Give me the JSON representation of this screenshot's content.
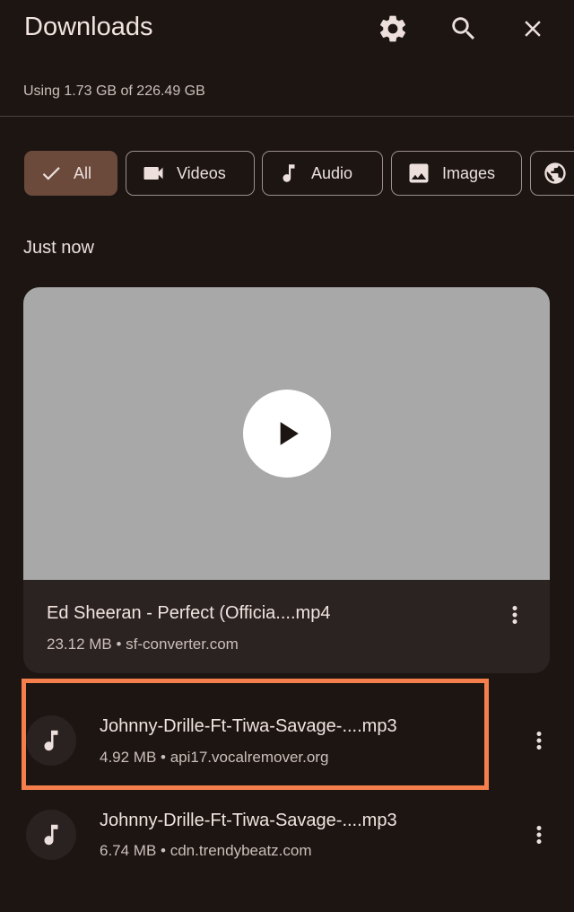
{
  "header": {
    "title": "Downloads",
    "storage": "Using 1.73 GB of 226.49 GB",
    "icons": [
      "settings-icon",
      "search-icon",
      "close-icon"
    ]
  },
  "filters": {
    "selected": "All",
    "chips": [
      {
        "label": "All",
        "icon": "check-icon"
      },
      {
        "label": "Videos",
        "icon": "video-icon"
      },
      {
        "label": "Audio",
        "icon": "music-note-icon"
      },
      {
        "label": "Images",
        "icon": "image-icon"
      },
      {
        "label": "",
        "icon": "globe-icon"
      }
    ]
  },
  "section": {
    "label": "Just now"
  },
  "items": [
    {
      "type": "video",
      "name": "Ed Sheeran - Perfect (Officia....mp4",
      "meta": "23.12 MB • sf-converter.com"
    },
    {
      "type": "audio",
      "name": "Johnny-Drille-Ft-Tiwa-Savage-....mp3",
      "meta": "4.92 MB • api17.vocalremover.org",
      "highlighted": true
    },
    {
      "type": "audio",
      "name": "Johnny-Drille-Ft-Tiwa-Savage-....mp3",
      "meta": "6.74 MB • cdn.trendybeatz.com"
    }
  ],
  "colors": {
    "background": "#1c1512",
    "chip_selected": "#6b4a3c",
    "highlight_border": "#f47f4d",
    "thumbnail": "#a8a8a8"
  }
}
